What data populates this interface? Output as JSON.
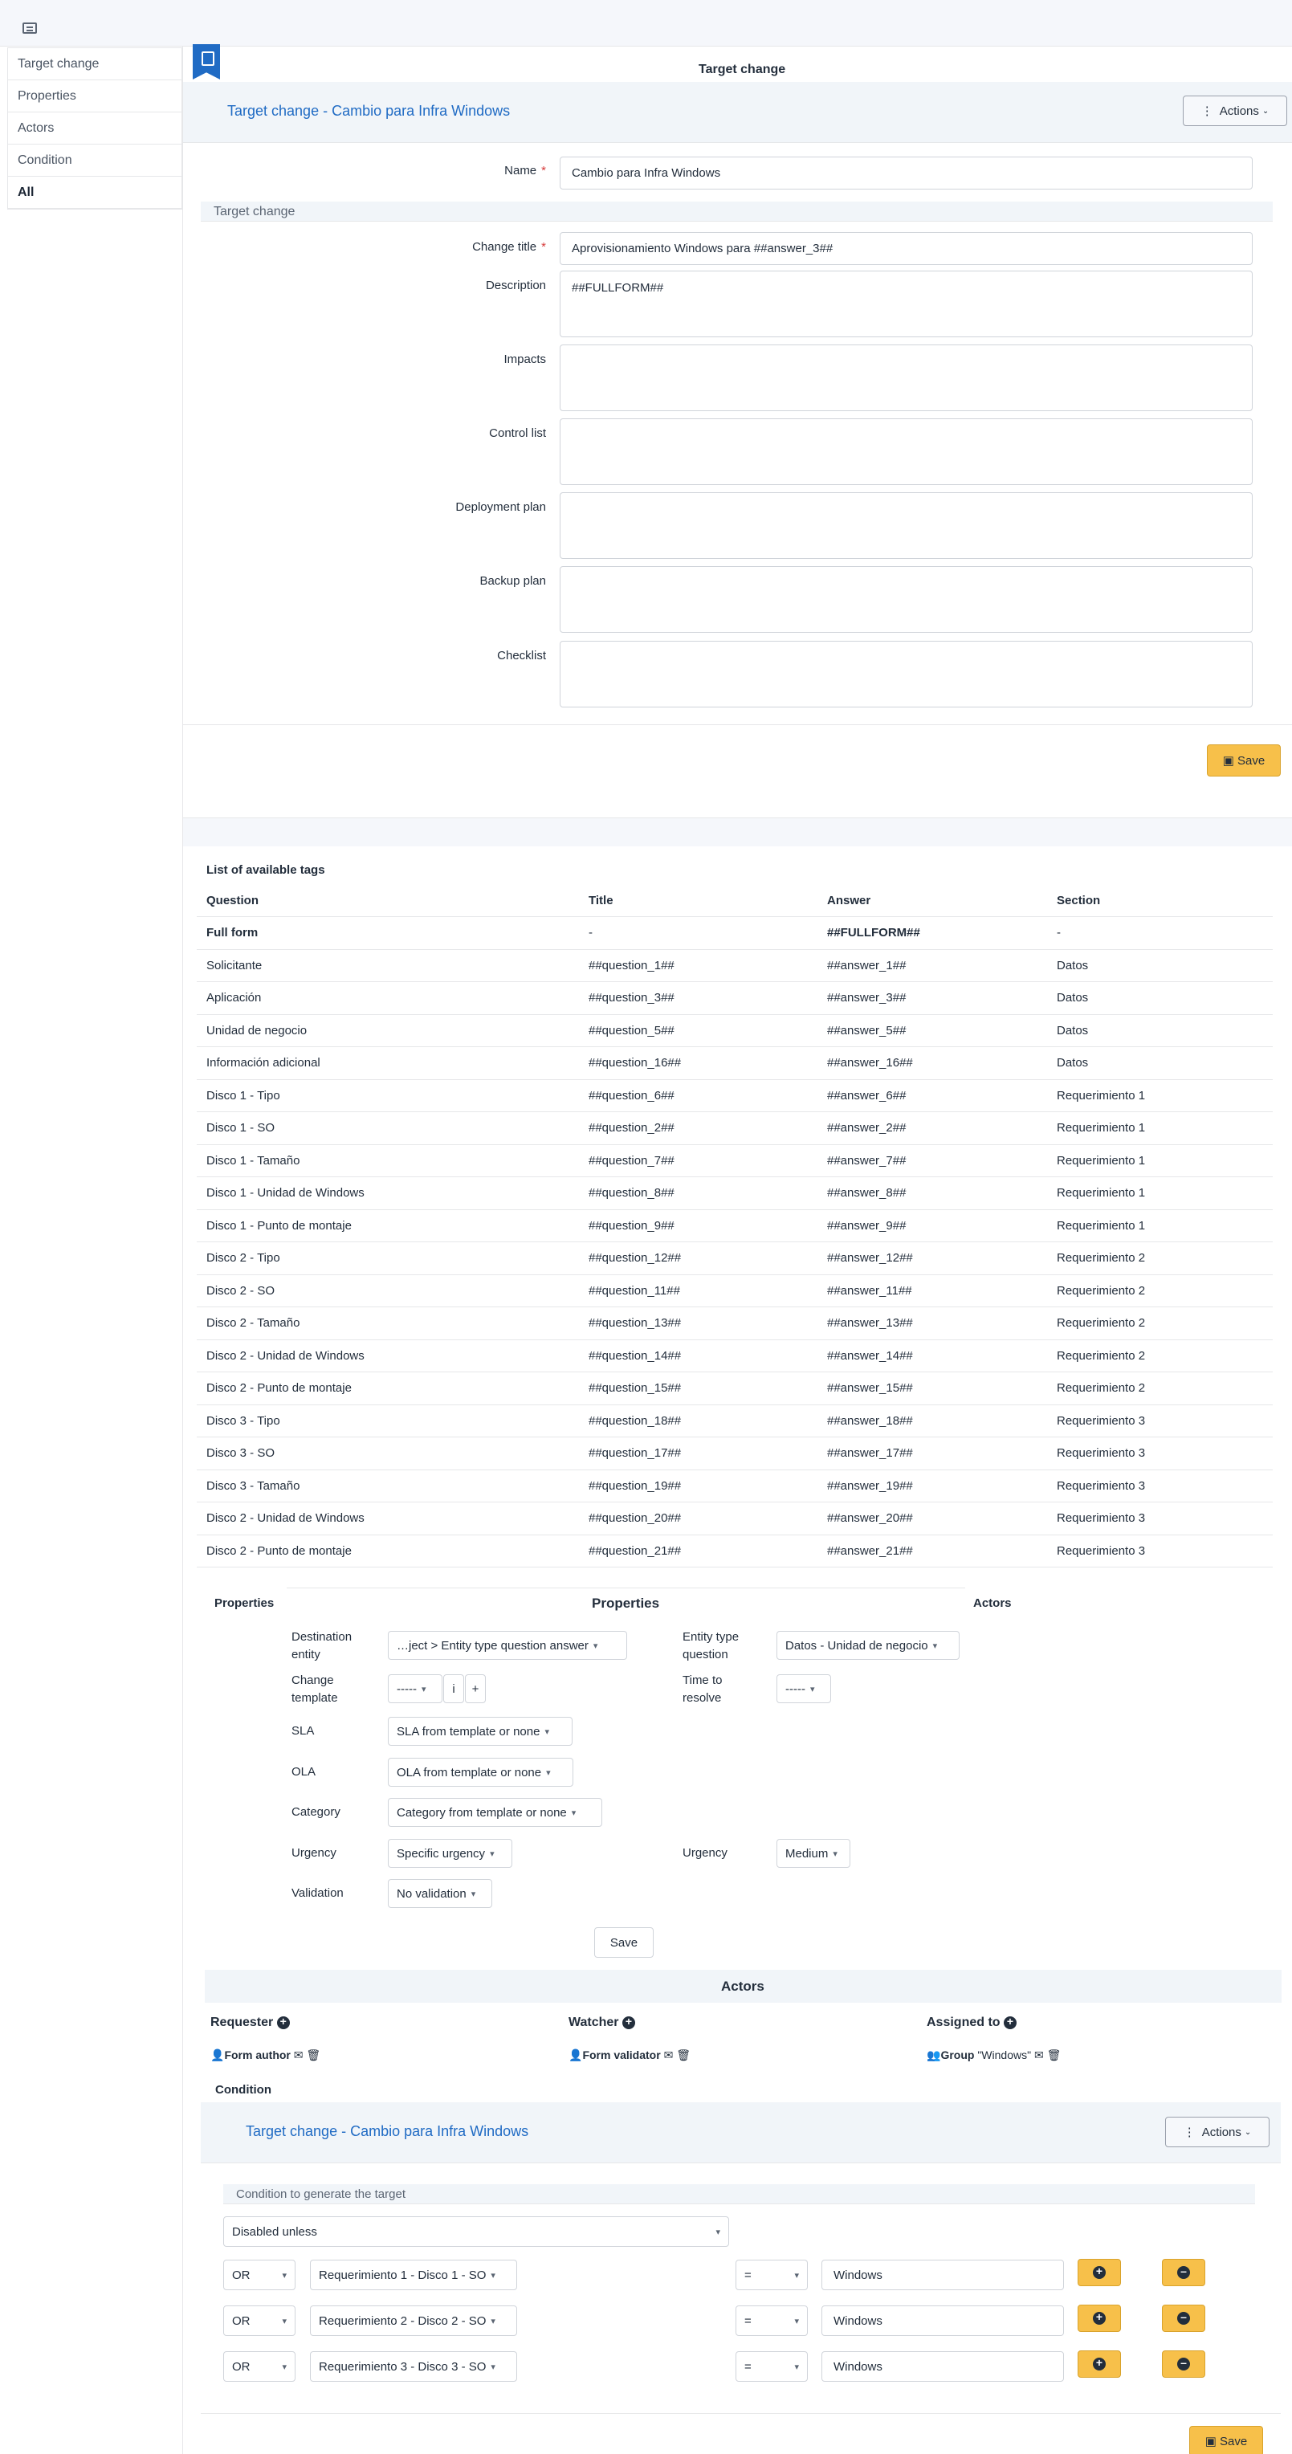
{
  "nav": [
    "Target change",
    "Properties",
    "Actors",
    "Condition",
    "All"
  ],
  "page_title": "Target change",
  "header": {
    "title": "Target change - Cambio para Infra Windows",
    "actions_label": "Actions"
  },
  "form": {
    "name_label": "Name",
    "name_value": "Cambio para Infra Windows",
    "section_label": "Target change",
    "change_title_label": "Change title",
    "change_title_value": "Aprovisionamiento Windows para ##answer_3##",
    "description_label": "Description",
    "description_value": "##FULLFORM##",
    "impacts_label": "Impacts",
    "control_list_label": "Control list",
    "deployment_plan_label": "Deployment plan",
    "backup_plan_label": "Backup plan",
    "checklist_label": "Checklist",
    "save_label": "Save"
  },
  "tags": {
    "title": "List of available tags",
    "columns": [
      "Question",
      "Title",
      "Answer",
      "Section"
    ],
    "rows": [
      [
        "Full form",
        "-",
        "##FULLFORM##",
        "-"
      ],
      [
        "Solicitante",
        "##question_1##",
        "##answer_1##",
        "Datos"
      ],
      [
        "Aplicación",
        "##question_3##",
        "##answer_3##",
        "Datos"
      ],
      [
        "Unidad de negocio",
        "##question_5##",
        "##answer_5##",
        "Datos"
      ],
      [
        "Información adicional",
        "##question_16##",
        "##answer_16##",
        "Datos"
      ],
      [
        "Disco 1 - Tipo",
        "##question_6##",
        "##answer_6##",
        "Requerimiento 1"
      ],
      [
        "Disco 1 - SO",
        "##question_2##",
        "##answer_2##",
        "Requerimiento 1"
      ],
      [
        "Disco 1 - Tamaño",
        "##question_7##",
        "##answer_7##",
        "Requerimiento 1"
      ],
      [
        "Disco 1 - Unidad de Windows",
        "##question_8##",
        "##answer_8##",
        "Requerimiento 1"
      ],
      [
        "Disco 1 - Punto de montaje",
        "##question_9##",
        "##answer_9##",
        "Requerimiento 1"
      ],
      [
        "Disco 2 - Tipo",
        "##question_12##",
        "##answer_12##",
        "Requerimiento 2"
      ],
      [
        "Disco 2 - SO",
        "##question_11##",
        "##answer_11##",
        "Requerimiento 2"
      ],
      [
        "Disco 2 - Tamaño",
        "##question_13##",
        "##answer_13##",
        "Requerimiento 2"
      ],
      [
        "Disco 2 - Unidad de Windows",
        "##question_14##",
        "##answer_14##",
        "Requerimiento 2"
      ],
      [
        "Disco 2 - Punto de montaje",
        "##question_15##",
        "##answer_15##",
        "Requerimiento 2"
      ],
      [
        "Disco 3 - Tipo",
        "##question_18##",
        "##answer_18##",
        "Requerimiento 3"
      ],
      [
        "Disco 3 - SO",
        "##question_17##",
        "##answer_17##",
        "Requerimiento 3"
      ],
      [
        "Disco 3 - Tamaño",
        "##question_19##",
        "##answer_19##",
        "Requerimiento 3"
      ],
      [
        "Disco 2 - Unidad de Windows",
        "##question_20##",
        "##answer_20##",
        "Requerimiento 3"
      ],
      [
        "Disco 2 - Punto de montaje",
        "##question_21##",
        "##answer_21##",
        "Requerimiento 3"
      ]
    ]
  },
  "properties": {
    "tab_left": "Properties",
    "title": "Properties",
    "tab_right": "Actors",
    "destination_entity_label": "Destination entity",
    "destination_entity_value": "…ject > Entity type question answer",
    "entity_type_question_label": "Entity type question",
    "entity_type_question_value": "Datos - Unidad de negocio",
    "change_template_label": "Change template",
    "change_template_value": "-----",
    "time_to_resolve_label": "Time to resolve",
    "time_to_resolve_value": "-----",
    "sla_label": "SLA",
    "sla_value": "SLA from template or none",
    "ola_label": "OLA",
    "ola_value": "OLA from template or none",
    "category_label": "Category",
    "category_value": "Category from template or none",
    "urgency_label": "Urgency",
    "urgency_value": "Specific urgency",
    "urgency2_label": "Urgency",
    "urgency2_value": "Medium",
    "validation_label": "Validation",
    "validation_value": "No validation",
    "save_label": "Save"
  },
  "actors": {
    "title": "Actors",
    "requester_label": "Requester",
    "requester_value": "Form author",
    "watcher_label": "Watcher",
    "watcher_value": "Form validator",
    "assigned_label": "Assigned to",
    "assigned_prefix": "Group",
    "assigned_value": "\"Windows\""
  },
  "condition": {
    "tab": "Condition",
    "header_title": "Target change - Cambio para Infra Windows",
    "actions_label": "Actions",
    "section_label": "Condition to generate the target",
    "mode_value": "Disabled unless",
    "rows": [
      {
        "logic": "OR",
        "field": "Requerimiento 1 - Disco 1 - SO",
        "op": "=",
        "value": "Windows"
      },
      {
        "logic": "OR",
        "field": "Requerimiento 2 - Disco 2 - SO",
        "op": "=",
        "value": "Windows"
      },
      {
        "logic": "OR",
        "field": "Requerimiento 3 - Disco 3 - SO",
        "op": "=",
        "value": "Windows"
      }
    ],
    "save_label": "Save"
  },
  "colors": {
    "accent": "#206bc4",
    "save": "#f7c04a",
    "band": "#f1f5f9"
  }
}
